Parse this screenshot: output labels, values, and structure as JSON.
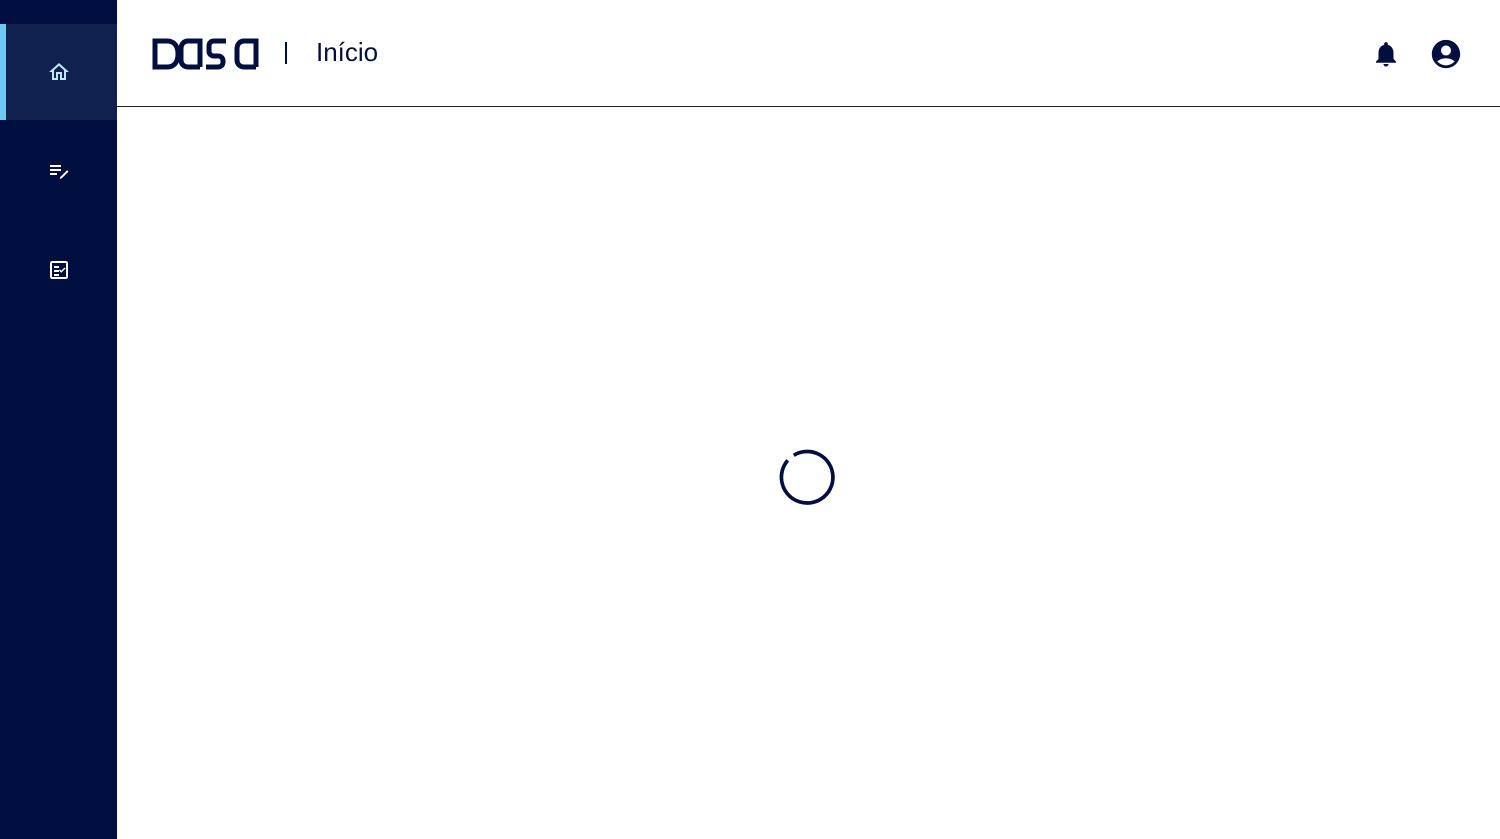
{
  "header": {
    "logo_alt": "dasa",
    "separator": "|",
    "page_title": "Início"
  },
  "sidebar": {
    "items": [
      {
        "icon": "home-icon",
        "active": true
      },
      {
        "icon": "edit-list-icon",
        "active": false
      },
      {
        "icon": "checklist-icon",
        "active": false
      }
    ]
  },
  "colors": {
    "sidebar_bg": "#000f3f",
    "sidebar_active_bg": "#10214f",
    "active_indicator": "#6ec8f5",
    "brand": "#000f3f"
  },
  "status": {
    "loading": true
  }
}
